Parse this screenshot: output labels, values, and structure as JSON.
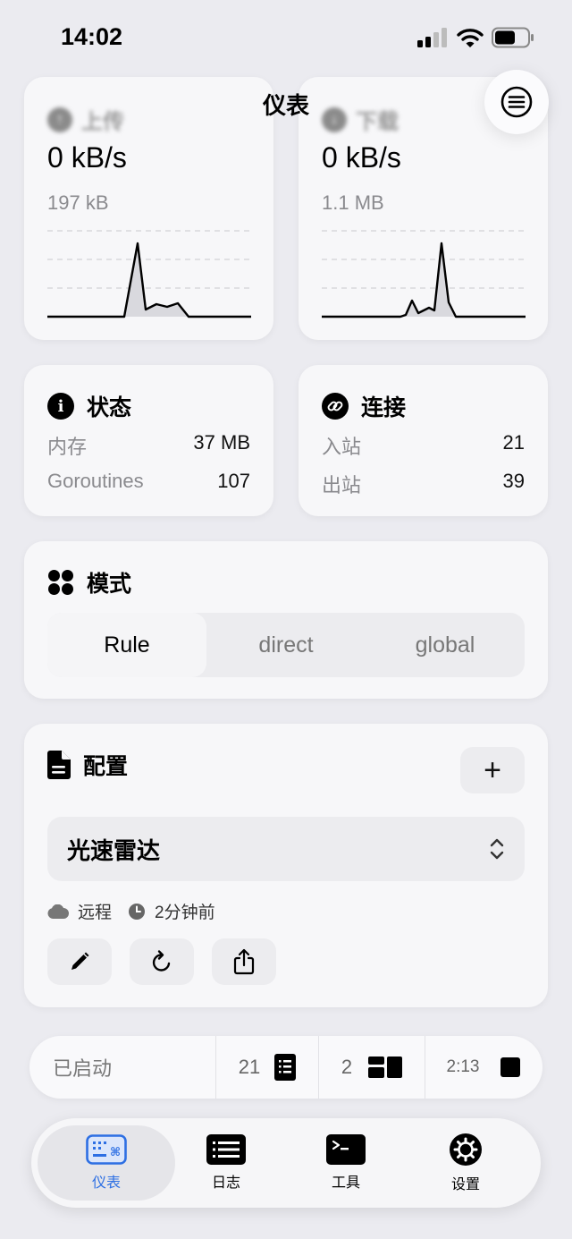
{
  "status_bar": {
    "time": "14:02"
  },
  "header": {
    "title": "仪表",
    "menu_icon": "list-circle-icon"
  },
  "upload": {
    "label": "上传",
    "speed": "0 kB/s",
    "total": "197 kB"
  },
  "download": {
    "label": "下载",
    "speed": "0 kB/s",
    "total": "1.1 MB"
  },
  "status_card": {
    "title": "状态",
    "rows": [
      {
        "key": "内存",
        "value": "37 MB"
      },
      {
        "key": "Goroutines",
        "value": "107"
      }
    ]
  },
  "connections_card": {
    "title": "连接",
    "rows": [
      {
        "key": "入站",
        "value": "21"
      },
      {
        "key": "出站",
        "value": "39"
      }
    ]
  },
  "mode_card": {
    "title": "模式",
    "options": [
      "Rule",
      "direct",
      "global"
    ],
    "selected": "Rule"
  },
  "profile_card": {
    "title": "配置",
    "add_label": "+",
    "selected_profile": "光速雷达",
    "type_label": "远程",
    "updated_label": "2分钟前"
  },
  "bottom_status": {
    "state": "已启动",
    "rules_count": "21",
    "groups_count": "2",
    "uptime": "2:13"
  },
  "tabs": [
    {
      "label": "仪表",
      "icon": "dashboard-icon",
      "active": true
    },
    {
      "label": "日志",
      "icon": "log-list-icon",
      "active": false
    },
    {
      "label": "工具",
      "icon": "terminal-icon",
      "active": false
    },
    {
      "label": "设置",
      "icon": "gear-icon",
      "active": false
    }
  ],
  "colors": {
    "accent": "#2d6fe3",
    "background": "#ebebf0",
    "card": "#f7f7f9"
  }
}
